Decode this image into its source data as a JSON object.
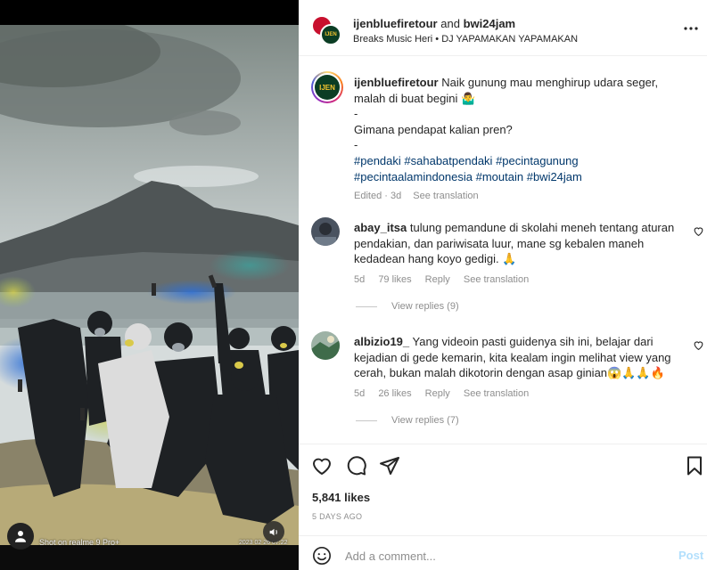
{
  "header": {
    "author": "ijenbluefiretour",
    "joiner": "and",
    "coauthor": "bwi24jam",
    "audio": "Breaks Music Heri • DJ YAPAMAKAN YAPAMAKAN",
    "avatar1_text": "",
    "avatar2_text": "IJEN",
    "more_icon": "more-horizontal-icon"
  },
  "media": {
    "shot_on": "Shot on realme 9 Pro+",
    "timestamp": "2023 02 26 07:22",
    "sound_icon": "volume-icon",
    "account_icon": "user-icon"
  },
  "caption": {
    "username": "ijenbluefiretour",
    "line1": "Naik gunung mau menghirup udara seger, malah di buat begini 🤷‍♂️",
    "dash1": "-",
    "line2": "Gimana pendapat kalian pren?",
    "dash2": "-",
    "hashtags": [
      "#pendaki",
      "#sahabatpendaki",
      "#pecintagunung",
      "#pecintaalamindonesia",
      "#moutain",
      "#bwi24jam"
    ],
    "edited": "Edited · 3d",
    "see_translation": "See translation",
    "avatar_text": "IJEN"
  },
  "comments": [
    {
      "username": "abay_itsa",
      "text": "tulung pemandune di skolahi meneh tentang aturan pendakian, dan pariwisata luur, mane sg kebalen maneh kedadean hang koyo gedigi. 🙏",
      "age": "5d",
      "likes": "79 likes",
      "reply": "Reply",
      "see_translation": "See translation",
      "view_replies": "View replies (9)"
    },
    {
      "username": "albizio19_",
      "text": "Yang videoin pasti guidenya sih ini, belajar dari kejadian di gede kemarin, kita kealam ingin melihat view yang cerah, bukan malah dikotorin dengan asap ginian😱🙏🙏🔥",
      "age": "5d",
      "likes": "26 likes",
      "reply": "Reply",
      "see_translation": "See translation",
      "view_replies": "View replies (7)"
    }
  ],
  "actions": {
    "like_icon": "heart-icon",
    "comment_icon": "comment-icon",
    "share_icon": "share-icon",
    "save_icon": "bookmark-icon"
  },
  "likes": "5,841 likes",
  "date": "5 DAYS AGO",
  "add_comment": {
    "emoji_icon": "emoji-icon",
    "placeholder": "Add a comment...",
    "post_label": "Post"
  },
  "colors": {
    "link": "#00376b",
    "muted": "#8e8e8e",
    "post_disabled": "#b2dffc",
    "smoke_blue": "#2d6fd6",
    "smoke_yellow": "#d8d24a"
  }
}
